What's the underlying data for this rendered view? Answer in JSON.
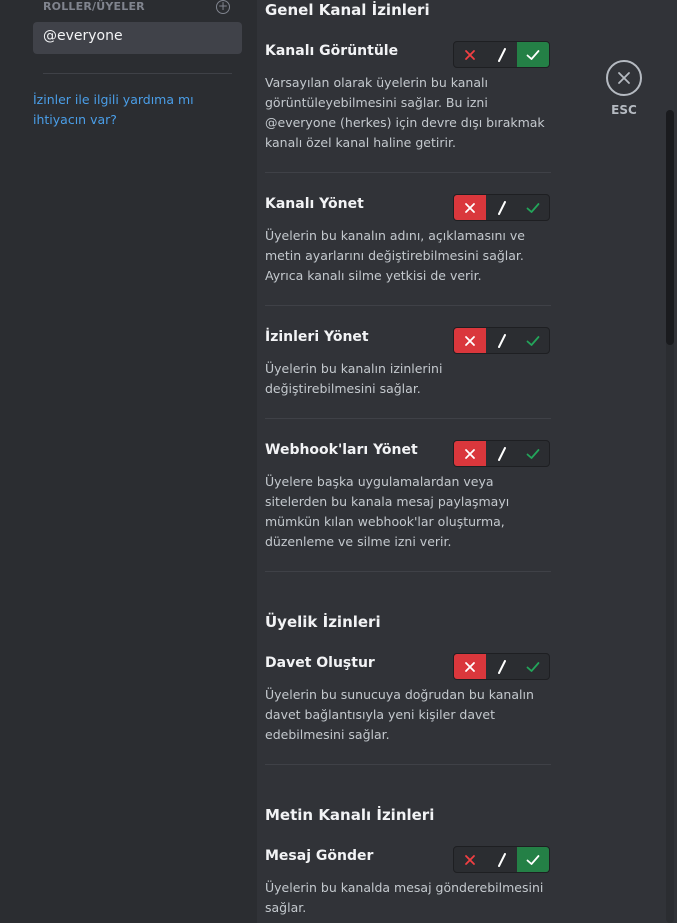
{
  "sidebar": {
    "roles_header": "ROLLER/ÜYELER",
    "add_role_icon": "plus-circle-icon",
    "selected_role": "@everyone",
    "help_link": "İzinler ile ilgili yardıma mı ihtiyacın var?"
  },
  "close": {
    "label": "ESC",
    "icon": "close-icon"
  },
  "sections": [
    {
      "title": "Genel Kanal İzinleri",
      "permissions": [
        {
          "title": "Kanalı Görüntüle",
          "state": "allow",
          "description": "Varsayılan olarak üyelerin bu kanalı görüntüleyebilmesini sağlar. Bu izni @everyone (herkes) için devre dışı bırakmak kanalı özel kanal haline getirir."
        },
        {
          "title": "Kanalı Yönet",
          "state": "deny",
          "description": "Üyelerin bu kanalın adını, açıklamasını ve metin ayarlarını değiştirebilmesini sağlar. Ayrıca kanalı silme yetkisi de verir."
        },
        {
          "title": "İzinleri Yönet",
          "state": "deny",
          "description": "Üyelerin bu kanalın izinlerini değiştirebilmesini sağlar."
        },
        {
          "title": "Webhook'ları Yönet",
          "state": "deny",
          "description": "Üyelere başka uygulamalardan veya sitelerden bu kanala mesaj paylaşmayı mümkün kılan webhook'lar oluşturma, düzenleme ve silme izni verir."
        }
      ]
    },
    {
      "title": "Üyelik İzinleri",
      "permissions": [
        {
          "title": "Davet Oluştur",
          "state": "deny",
          "description": "Üyelerin bu sunucuya doğrudan bu kanalın davet bağlantısıyla yeni kişiler davet edebilmesini sağlar."
        }
      ]
    },
    {
      "title": "Metin Kanalı İzinleri",
      "permissions": [
        {
          "title": "Mesaj Gönder",
          "state": "allow",
          "description": "Üyelerin bu kanalda mesaj gönderebilmesini sağlar."
        }
      ]
    }
  ],
  "toggle_icons": {
    "deny": "x-icon",
    "passthrough": "slash-icon",
    "allow": "check-icon"
  },
  "colors": {
    "deny_active": "#da373c",
    "allow_active": "#248046",
    "link": "#4a9ee8"
  }
}
